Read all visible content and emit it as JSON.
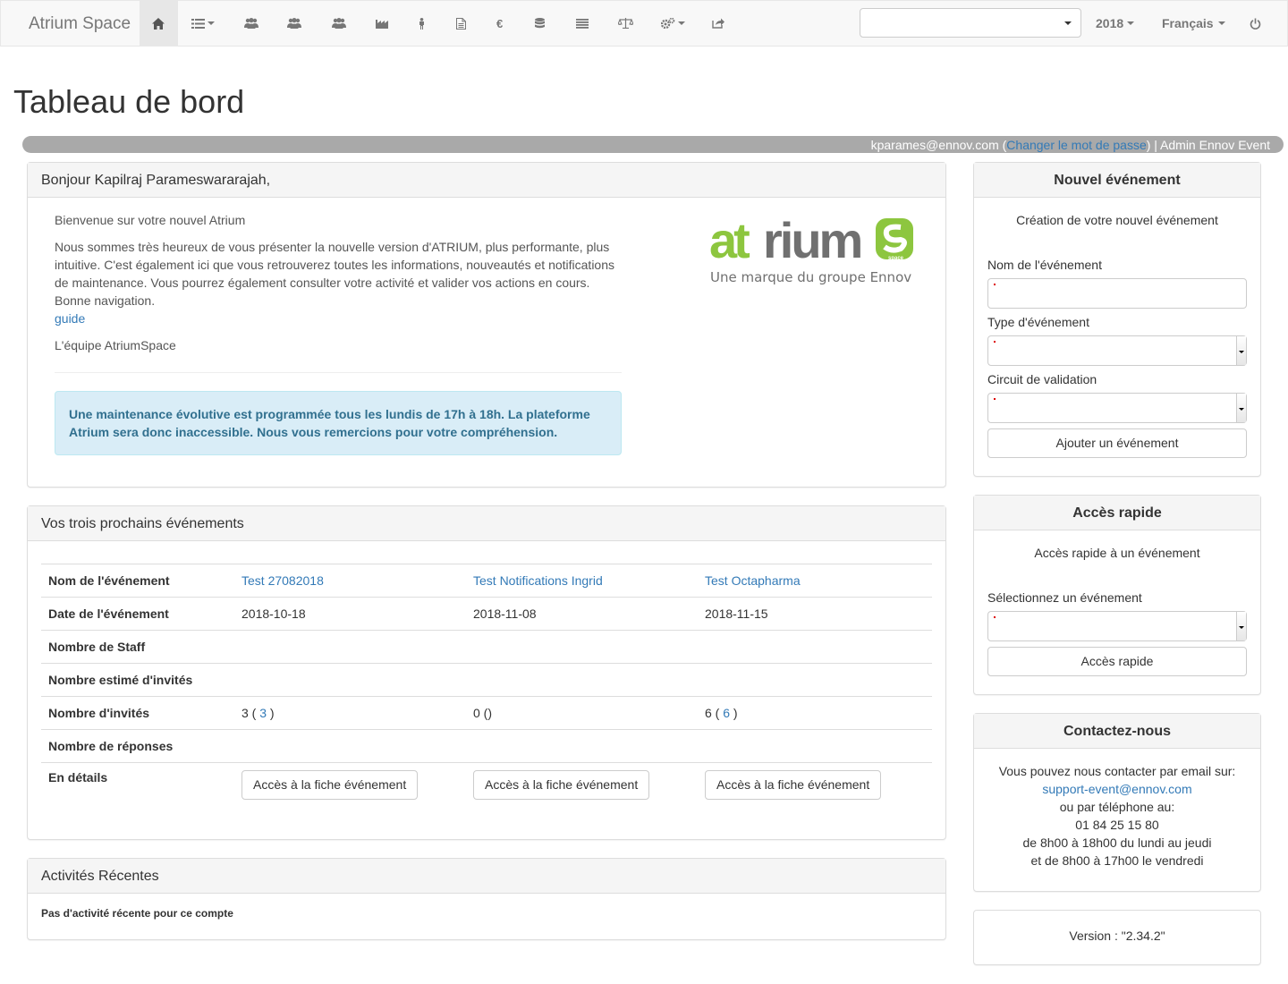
{
  "navbar": {
    "brand": "Atrium Space",
    "icons": [
      "home-icon",
      "list-icon",
      "users-icon",
      "users-icon",
      "users-icon",
      "factory-icon",
      "person-icon",
      "document-icon",
      "euro-icon",
      "database-icon",
      "lines-icon",
      "balance-icon",
      "cogs-icon",
      "share-icon",
      "power-icon"
    ],
    "euro": "€",
    "year": "2018",
    "language": "Français"
  },
  "page_title": "Tableau de bord",
  "userbar": {
    "email": "kparames@ennov.com",
    "open": " (",
    "change_password": "Changer le mot de passe",
    "close_role": ") | Admin Ennov Event"
  },
  "welcome": {
    "greeting": "Bonjour Kapilraj Parameswararajah,",
    "intro": "Bienvenue sur votre nouvel Atrium",
    "body": "Nous sommes très heureux de vous présenter la nouvelle version d'ATRIUM, plus performante, plus intuitive. C'est également ici que vous retrouverez toutes les informations, nouveautés et notifications de maintenance. Vous pourrez également consulter votre activité et valider vos actions en cours. Bonne navigation.",
    "guide_link": "guide",
    "signature": "L'équipe AtriumSpace",
    "alert": "Une maintenance évolutive est programmée tous les lundis de 17h à 18h. La plateforme Atrium sera donc inaccessible. Nous vous remercions pour votre compréhension.",
    "logo_word_left": "at",
    "logo_word_right": "rium",
    "logo_badge": "space",
    "logo_tagline": "Une marque du groupe Ennov"
  },
  "events": {
    "title": "Vos trois prochains événements",
    "row_labels": {
      "name": "Nom de l'événement",
      "date": "Date de l'événement",
      "staff": "Nombre de Staff",
      "estimated": "Nombre estimé d'invités",
      "guests": "Nombre d'invités",
      "responses": "Nombre de réponses",
      "details": "En détails"
    },
    "items": [
      {
        "name": "Test 27082018",
        "date": "2018-10-18",
        "guests_count": "3",
        "guests_open": " ( ",
        "guests_link": "3",
        "guests_close": " )",
        "detail_button": "Accès à la fiche événement"
      },
      {
        "name": "Test Notifications Ingrid",
        "date": "2018-11-08",
        "guests_count": "0",
        "guests_open": " (",
        "guests_link": "",
        "guests_close": ")",
        "detail_button": "Accès à la fiche événement"
      },
      {
        "name": "Test Octapharma",
        "date": "2018-11-15",
        "guests_count": "6",
        "guests_open": " ( ",
        "guests_link": "6",
        "guests_close": " )",
        "detail_button": "Accès à la fiche événement"
      }
    ]
  },
  "activities": {
    "title": "Activités Récentes",
    "empty": "Pas d'activité récente pour ce compte"
  },
  "new_event": {
    "title": "Nouvel événement",
    "subtitle": "Création de votre nouvel événement",
    "name_label": "Nom de l'événement",
    "type_label": "Type d'événement",
    "circuit_label": "Circuit de validation",
    "add_button": "Ajouter un événement"
  },
  "quick_access": {
    "title": "Accès rapide",
    "subtitle": "Accès rapide à un événement",
    "select_label": "Sélectionnez un événement",
    "button": "Accès rapide"
  },
  "contact": {
    "title": "Contactez-nous",
    "line1": "Vous pouvez nous contacter par email sur:",
    "email": "support-event@ennov.com",
    "line2": "ou par téléphone au:",
    "phone": "01 84 25 15 80",
    "hours1": "de 8h00 à 18h00 du lundi au jeudi",
    "hours2": "et de 8h00 à 17h00 le vendredi"
  },
  "version": {
    "text": "Version : \"2.34.2\""
  },
  "colors": {
    "accent_link": "#337ab7",
    "logo_green": "#8dc63f",
    "logo_gray": "#707070",
    "alert_text": "#31708f",
    "alert_bg": "#d9edf7"
  }
}
